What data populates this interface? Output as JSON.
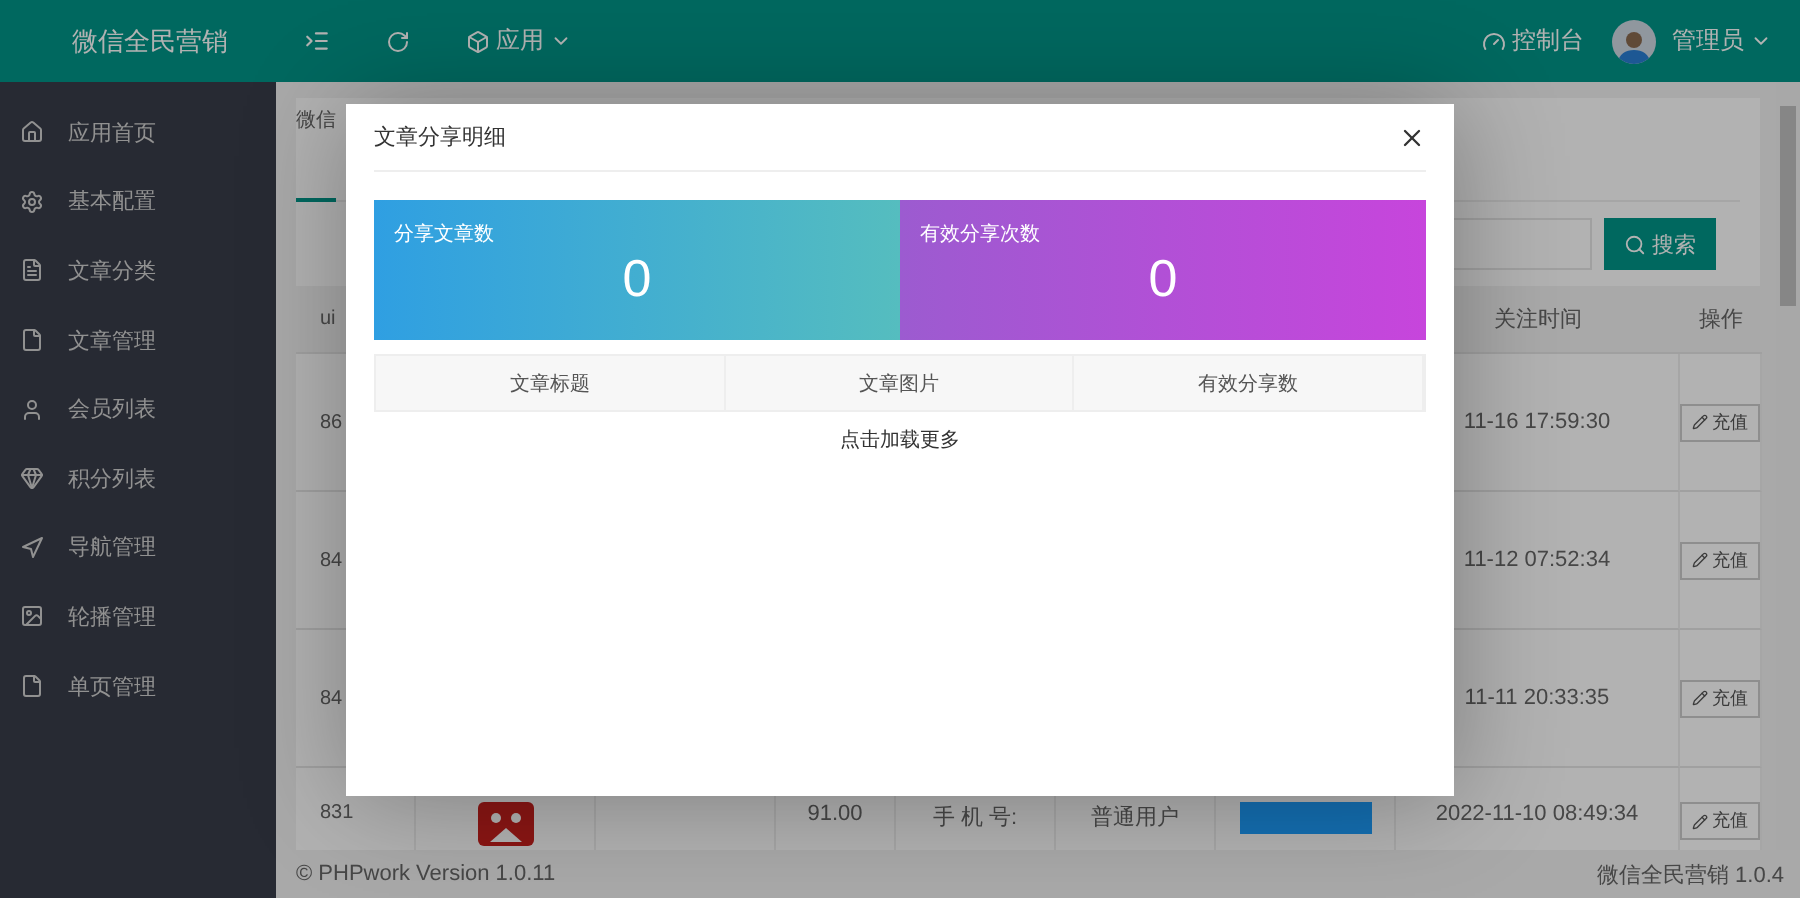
{
  "header": {
    "brand": "微信全民营销",
    "app_menu": "应用",
    "console": "控制台",
    "user": "管理员"
  },
  "sidebar": {
    "items": [
      {
        "label": "应用首页",
        "selected": false
      },
      {
        "label": "基本配置",
        "selected": false
      },
      {
        "label": "文章分类",
        "selected": false
      },
      {
        "label": "文章管理",
        "selected": false
      },
      {
        "label": "会员列表",
        "selected": false
      },
      {
        "label": "积分列表",
        "selected": false
      },
      {
        "label": "导航管理",
        "selected": false
      },
      {
        "label": "轮播管理",
        "selected": false
      },
      {
        "label": "单页管理",
        "selected": false
      }
    ]
  },
  "page_tab": {
    "label": "微信",
    "selected": true
  },
  "search": {
    "button": "搜索"
  },
  "table": {
    "columns": [
      "ui",
      "关注时间",
      "操作"
    ],
    "rows": [
      {
        "uid": "86",
        "time": "11-16 17:59:30",
        "action": "充值"
      },
      {
        "uid": "84",
        "time": "11-12 07:52:34",
        "action": "充值"
      },
      {
        "uid": "84",
        "time": "11-11 20:33:35",
        "action": "充值"
      },
      {
        "uid": "831",
        "price": "91.00",
        "contact": "手 机 号:",
        "level": "普通用户",
        "time": "2022-11-10 08:49:34",
        "action": "充值",
        "kind": "full"
      }
    ]
  },
  "footer": {
    "left": "© PHPwork Version 1.0.11",
    "right": "微信全民营销 1.0.4"
  },
  "modal": {
    "title": "文章分享明细",
    "stats": [
      {
        "label": "分享文章数",
        "value": "0",
        "kind": "blue"
      },
      {
        "label": "有效分享次数",
        "value": "0",
        "kind": "purple"
      }
    ],
    "columns": [
      "文章标题",
      "文章图片",
      "有效分享数"
    ],
    "load_more": "点击加载更多"
  }
}
